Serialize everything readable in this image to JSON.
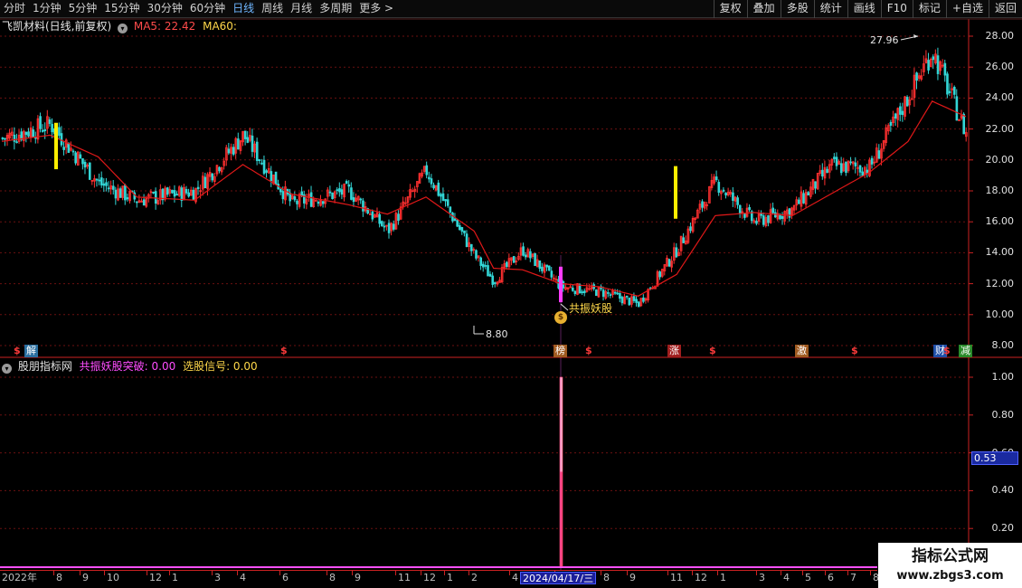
{
  "toolbar": {
    "periods": [
      {
        "label": "分时"
      },
      {
        "label": "1分钟"
      },
      {
        "label": "5分钟"
      },
      {
        "label": "15分钟"
      },
      {
        "label": "30分钟"
      },
      {
        "label": "60分钟"
      },
      {
        "label": "日线",
        "active": true
      },
      {
        "label": "周线"
      },
      {
        "label": "月线"
      },
      {
        "label": "多周期"
      },
      {
        "label": "更多 >"
      }
    ],
    "tools": [
      "复权",
      "叠加",
      "多股",
      "统计",
      "画线",
      "F10",
      "标记",
      "+自选",
      "返回"
    ]
  },
  "main_header": {
    "stock_title": "飞凯材料(日线,前复权)",
    "ma5_label": "MA5: 22.42",
    "ma60_label": "MA60:"
  },
  "indicator_header": {
    "name": "股朋指标网",
    "signal1": "共振妖股突破: 0.00",
    "signal2": "选股信号: 0.00"
  },
  "annotations": {
    "high": "27.96",
    "low": "8.80",
    "signal_text": "共振妖股"
  },
  "price_axis": [
    "28.00",
    "26.00",
    "24.00",
    "22.00",
    "20.00",
    "18.00",
    "16.00",
    "14.00",
    "12.00",
    "10.00",
    "8.00"
  ],
  "indicator_axis": [
    "1.00",
    "0.80",
    "0.60",
    "0.40",
    "0.20"
  ],
  "indicator_current": "0.53",
  "events": [
    {
      "text": "$",
      "type": "dollar"
    },
    {
      "text": "解",
      "type": "box",
      "color": "#2a6fa0"
    },
    {
      "text": "$",
      "type": "dollar"
    },
    {
      "text": "榜",
      "type": "box",
      "color": "#a05a20"
    },
    {
      "text": "$",
      "type": "dollar"
    },
    {
      "text": "涨",
      "type": "box",
      "color": "#a01e1e"
    },
    {
      "text": "$",
      "type": "dollar"
    },
    {
      "text": "激",
      "type": "box",
      "color": "#a05a20"
    },
    {
      "text": "$",
      "type": "dollar"
    },
    {
      "text": "财",
      "type": "box",
      "color": "#1f4fa8"
    },
    {
      "text": "$",
      "type": "dollar"
    },
    {
      "text": "减",
      "type": "box",
      "color": "#2a8a2a"
    }
  ],
  "date_axis": [
    "2022年",
    "8",
    "9",
    "10",
    "12",
    "1",
    "3",
    "4",
    "6",
    "8",
    "9",
    "11",
    "12",
    "1",
    "2",
    "4",
    "6",
    "8",
    "9",
    "11",
    "12",
    "1",
    "3",
    "4",
    "5",
    "6",
    "7",
    "8"
  ],
  "selected_date": "2024/04/17/三",
  "chart_data": {
    "type": "candlestick",
    "title": "飞凯材料(日线,前复权)",
    "ylim": [
      8,
      28.8
    ],
    "high": 27.96,
    "low": 8.8,
    "close_path_x": [
      0,
      0.05,
      0.1,
      0.14,
      0.2,
      0.25,
      0.3,
      0.36,
      0.4,
      0.44,
      0.49,
      0.51,
      0.54,
      0.58,
      0.62,
      0.66,
      0.7,
      0.74,
      0.78,
      0.82,
      0.86,
      0.9,
      0.94,
      0.965,
      1.0
    ],
    "close_path_y": [
      21.4,
      22.3,
      18.5,
      17.4,
      18.0,
      21.6,
      17.2,
      18.0,
      15.4,
      19.3,
      13.8,
      12.2,
      14.2,
      11.8,
      11.5,
      10.7,
      14.2,
      18.6,
      16.0,
      16.8,
      19.6,
      19.5,
      24.1,
      27.1,
      21.7
    ],
    "ma_path_y": [
      21.2,
      21.6,
      20.2,
      17.6,
      17.4,
      19.7,
      17.8,
      17.1,
      16.5,
      17.6,
      15.4,
      13.0,
      12.9,
      12.0,
      11.8,
      11.2,
      12.6,
      16.4,
      16.6,
      16.4,
      17.8,
      19.2,
      21.2,
      23.8,
      22.8
    ],
    "indicator": {
      "name": "共振妖股突破",
      "spike_date": "2024/04/17",
      "spike_value": 1.0,
      "ylim": [
        0,
        1.1
      ]
    }
  }
}
